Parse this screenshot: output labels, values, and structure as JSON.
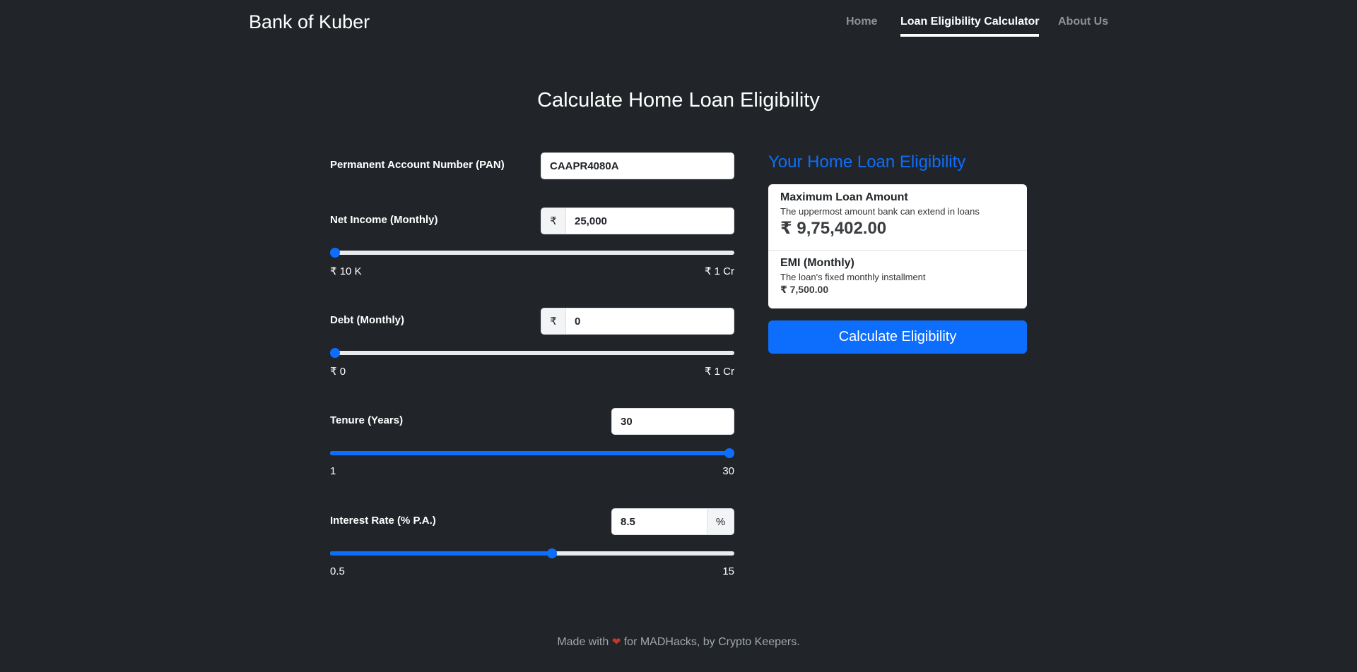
{
  "navbar": {
    "brand": "Bank of Kuber",
    "links": [
      {
        "label": "Home",
        "active": false
      },
      {
        "label": "Loan Eligibility Calculator",
        "active": true
      },
      {
        "label": "About Us",
        "active": false
      }
    ]
  },
  "page_title": "Calculate Home Loan Eligibility",
  "form": {
    "pan": {
      "label": "Permanent Account Number (PAN)",
      "value": "CAAPR4080A"
    },
    "income": {
      "label": "Net Income (Monthly)",
      "prefix": "₹",
      "value": "25,000",
      "min_label": "₹ 10 K",
      "max_label": "₹ 1 Cr",
      "slider_fraction": 0.0
    },
    "debt": {
      "label": "Debt (Monthly)",
      "prefix": "₹",
      "value": "0",
      "min_label": "₹ 0",
      "max_label": "₹ 1 Cr",
      "slider_fraction": 0.0
    },
    "tenure": {
      "label": "Tenure (Years)",
      "value": "30",
      "min_label": "1",
      "max_label": "30",
      "slider_fraction": 1.0
    },
    "interest": {
      "label": "Interest Rate (% P.A.)",
      "value": "8.5",
      "suffix": "%",
      "min_label": "0.5",
      "max_label": "15",
      "slider_fraction": 0.55
    }
  },
  "result": {
    "title": "Your Home Loan Eligibility",
    "max_loan": {
      "title": "Maximum Loan Amount",
      "desc": "The uppermost amount bank can extend in loans",
      "value": "₹ 9,75,402.00"
    },
    "emi": {
      "title": "EMI (Monthly)",
      "desc": "The loan's fixed monthly installment",
      "value": "₹ 7,500.00"
    },
    "button_label": "Calculate Eligibility"
  },
  "footer": {
    "prefix": "Made with",
    "heart": "❤",
    "suffix": "for MADHacks, by Crypto Keepers."
  },
  "colors": {
    "accent": "#0d6efd",
    "background": "#212529"
  }
}
